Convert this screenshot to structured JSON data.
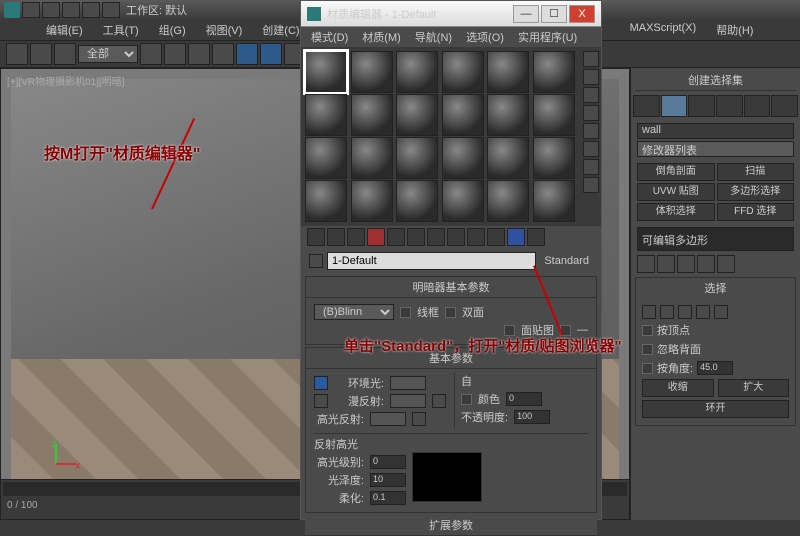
{
  "app": {
    "workspace_label": "工作区: 默认"
  },
  "menu": {
    "edit": "编辑(E)",
    "tools": "工具(T)",
    "group": "组(G)",
    "views": "视图(V)",
    "create": "创建(C)",
    "maxscript": "MAXScript(X)",
    "help": "帮助(H)"
  },
  "toolbar": {
    "selection_filter": "全部"
  },
  "viewport": {
    "label": "[+][VR物理摄影机01][明暗]"
  },
  "timeline": {
    "range": "0 / 100"
  },
  "annotations": {
    "a1": "按M打开\"材质编辑器\"",
    "a2": "单击\"Standard\"，打开\"材质/贴图浏览器\""
  },
  "mateditor": {
    "title": "材质编辑器 - 1-Default",
    "menu": {
      "modes": "模式(D)",
      "material": "材质(M)",
      "navigation": "导航(N)",
      "options": "选项(O)",
      "utilities": "实用程序(U)"
    },
    "win": {
      "min": "—",
      "max": "☐",
      "close": "X"
    },
    "name": "1-Default",
    "type_button": "Standard",
    "rollouts": {
      "shader_basic": "明暗器基本参数",
      "basic": "基本参数",
      "extended": "扩展参数"
    },
    "shader": "(B)Blinn",
    "checkboxes": {
      "wire": "线框",
      "twosided": "双面",
      "facemap": "面贴图",
      "faceted": "—"
    },
    "labels": {
      "ambient": "环境光:",
      "diffuse": "漫反射:",
      "specular": "高光反射:",
      "selfillum_group": "自",
      "color": "颜色",
      "opacity": "不透明度:",
      "highlights": "反射高光",
      "specular_level": "高光级别:",
      "glossiness": "光泽度:",
      "soften": "柔化:"
    },
    "values": {
      "selfillum": "0",
      "opacity": "100",
      "specular_level": "0",
      "glossiness": "10",
      "soften": "0.1"
    }
  },
  "cmdpanel": {
    "rollout_title": "创建选择集",
    "object_name": "wall",
    "modifier_label": "修改器列表",
    "sub": {
      "vertex": "倒角剖面",
      "edge": "扫描",
      "border": "UVW 贴图",
      "poly": "多边形选择",
      "element": "体积选择",
      "ffd": "FFD 选择"
    },
    "stack_item": "可编辑多边形",
    "selection": {
      "title": "选择",
      "by_vertex": "按顶点",
      "ignore_backfacing": "忽略背面",
      "by_angle": "按角度:",
      "angle_value": "45.0",
      "shrink": "收缩",
      "grow": "扩大",
      "ring": "环开"
    }
  }
}
